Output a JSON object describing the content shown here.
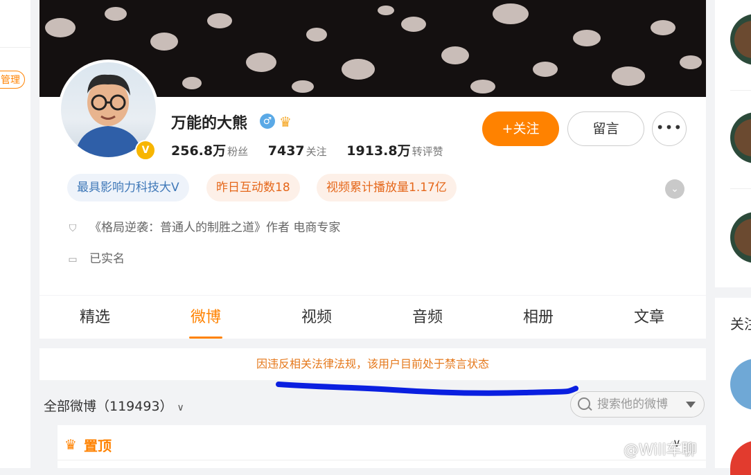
{
  "left_sidebar": {
    "manage_label": "管理"
  },
  "profile": {
    "name": "万能的大熊",
    "gender_icon": "♂",
    "verified_badge": "V",
    "stats": [
      {
        "value": "256.8万",
        "label": "粉丝"
      },
      {
        "value": "7437",
        "label": "关注"
      },
      {
        "value": "1913.8万",
        "label": "转评赞"
      }
    ],
    "follow_label": "+关注",
    "message_label": "留言",
    "more_label": "•••",
    "tags": [
      "最具影响力科技大V",
      "昨日互动数18",
      "视频累计播放量1.17亿"
    ],
    "info_lines": [
      "《格局逆袭：普通人的制胜之道》作者 电商专家",
      "已实名"
    ]
  },
  "tabs": [
    {
      "label": "精选",
      "active": false
    },
    {
      "label": "微博",
      "active": true
    },
    {
      "label": "视频",
      "active": false
    },
    {
      "label": "音频",
      "active": false
    },
    {
      "label": "相册",
      "active": false
    },
    {
      "label": "文章",
      "active": false
    }
  ],
  "banned_notice": "因违反相关法律法规，该用户目前处于禁言状态",
  "feed_filter": {
    "label": "全部微博（119493）"
  },
  "search": {
    "placeholder": "搜索他的微博"
  },
  "pinned": {
    "label": "置顶"
  },
  "watermark": "@Will车聊",
  "right_panel": {
    "section_title": "关注"
  },
  "colors": {
    "accent": "#ff8200",
    "link_blue": "#3f78b8",
    "scribble": "#0a1fe0"
  }
}
